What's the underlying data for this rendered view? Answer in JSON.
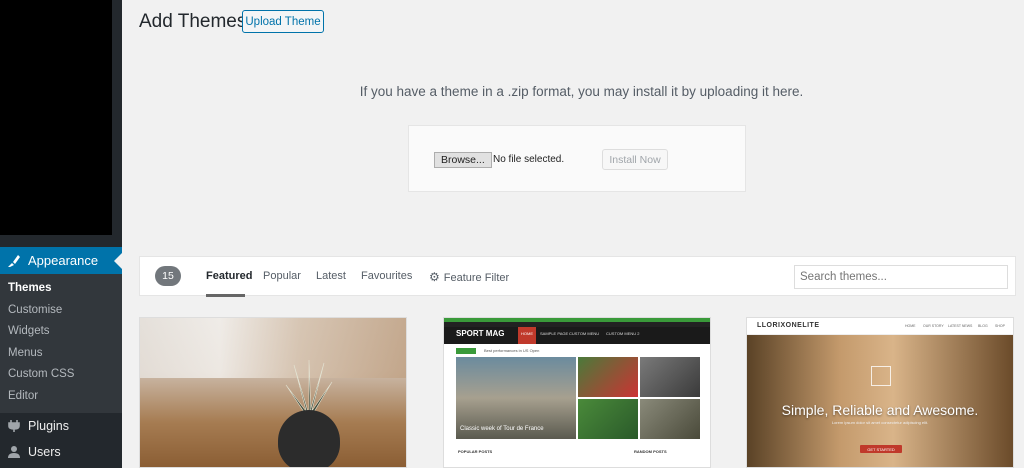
{
  "sidebar": {
    "appearance": "Appearance",
    "submenu": [
      "Themes",
      "Customise",
      "Widgets",
      "Menus",
      "Custom CSS",
      "Editor"
    ],
    "plugins": "Plugins",
    "users": "Users"
  },
  "header": {
    "title": "Add Themes",
    "upload_button": "Upload Theme"
  },
  "upload": {
    "description": "If you have a theme in a .zip format, you may install it by uploading it here.",
    "browse": "Browse...",
    "file_status": "No file selected.",
    "install": "Install Now"
  },
  "filter": {
    "count": "15",
    "tabs": [
      "Featured",
      "Popular",
      "Latest",
      "Favourites"
    ],
    "feature_filter": "Feature Filter",
    "search_placeholder": "Search themes..."
  },
  "themes": {
    "sportmag": {
      "logo": "SPORT MAG",
      "nav": [
        "HOME",
        "SAMPLE PAGE",
        "CUSTOM MENU",
        "CUSTOM MENU 2"
      ],
      "badge": "LATEST",
      "ticker": "Best performances in US Open",
      "hero_title": "Classic week of Tour de France",
      "sections": [
        "POPULAR POSTS",
        "RANDOM POSTS"
      ]
    },
    "llorix": {
      "logo": "LLORIXONELITE",
      "nav": [
        "HOME",
        "OUR STORY",
        "LATEST NEWS",
        "BLOG",
        "SHOP"
      ],
      "title": "Simple, Reliable and Awesome.",
      "subtitle": "Lorem ipsum dolor sit amet consectetur adipiscing elit.",
      "button": "GET STARTED"
    }
  },
  "colors": {
    "sidebar": "#23282d",
    "accent": "#0073aa",
    "background": "#f1f1f1"
  }
}
